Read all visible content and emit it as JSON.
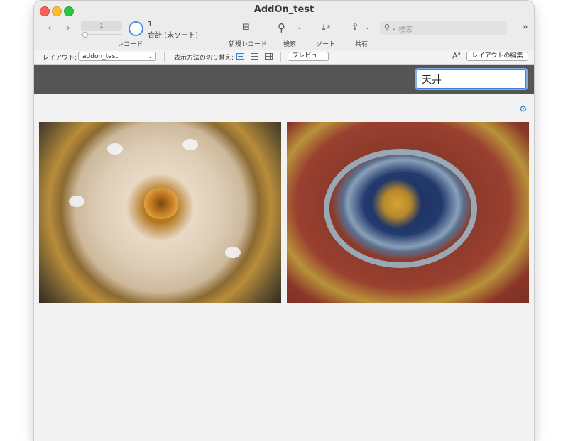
{
  "window": {
    "title": "AddOn_test"
  },
  "toolbar": {
    "record_field": "1",
    "record_count": "1",
    "record_total": "合計 (未ソート)",
    "record_label": "レコード",
    "new_record_label": "新規レコード",
    "find_label": "検索",
    "sort_label": "ソート",
    "share_label": "共有",
    "search_placeholder": "検索"
  },
  "layout_bar": {
    "layout_label": "レイアウト:",
    "layout_value": "addon_test",
    "view_switch_label": "表示方法の切り替え:",
    "preview_button": "プレビュー",
    "edit_layout_button": "レイアウトの編集"
  },
  "record": {
    "title_field_value": "天井"
  },
  "icons": {
    "accent": "#3b82d6",
    "gear_color": "#2f84c9"
  }
}
